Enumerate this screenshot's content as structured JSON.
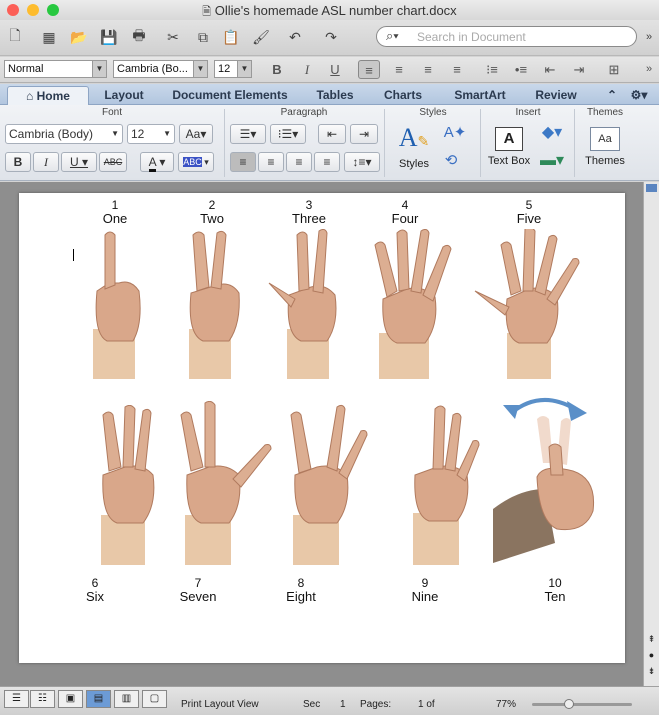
{
  "window": {
    "title": "Ollie's homemade ASL number chart.docx"
  },
  "search": {
    "placeholder": "Search in Document"
  },
  "format": {
    "style": "Normal",
    "font": "Cambria (Bo...",
    "size": "12"
  },
  "tabs": [
    "Home",
    "Layout",
    "Document Elements",
    "Tables",
    "Charts",
    "SmartArt",
    "Review"
  ],
  "ribbon": {
    "groups": {
      "font": "Font",
      "paragraph": "Paragraph",
      "styles": "Styles",
      "insert": "Insert",
      "themes": "Themes"
    },
    "font_name": "Cambria (Body)",
    "font_size": "12",
    "styles_label": "Styles",
    "textbox_label": "Text Box",
    "themes_label": "Themes"
  },
  "chart": {
    "numbers": [
      "1",
      "2",
      "3",
      "4",
      "5",
      "6",
      "7",
      "8",
      "9",
      "10"
    ],
    "words": [
      "One",
      "Two",
      "Three",
      "Four",
      "Five",
      "Six",
      "Seven",
      "Eight",
      "Nine",
      "Ten"
    ]
  },
  "status": {
    "view": "Print Layout View",
    "sec_label": "Sec",
    "sec_value": "1",
    "pages_label": "Pages:",
    "pages_value": "1 of",
    "zoom": "77%"
  },
  "colors": {
    "accent": "#3f6fb0",
    "skin": "#d9a78a",
    "sleeve": "#e8c8a8"
  }
}
